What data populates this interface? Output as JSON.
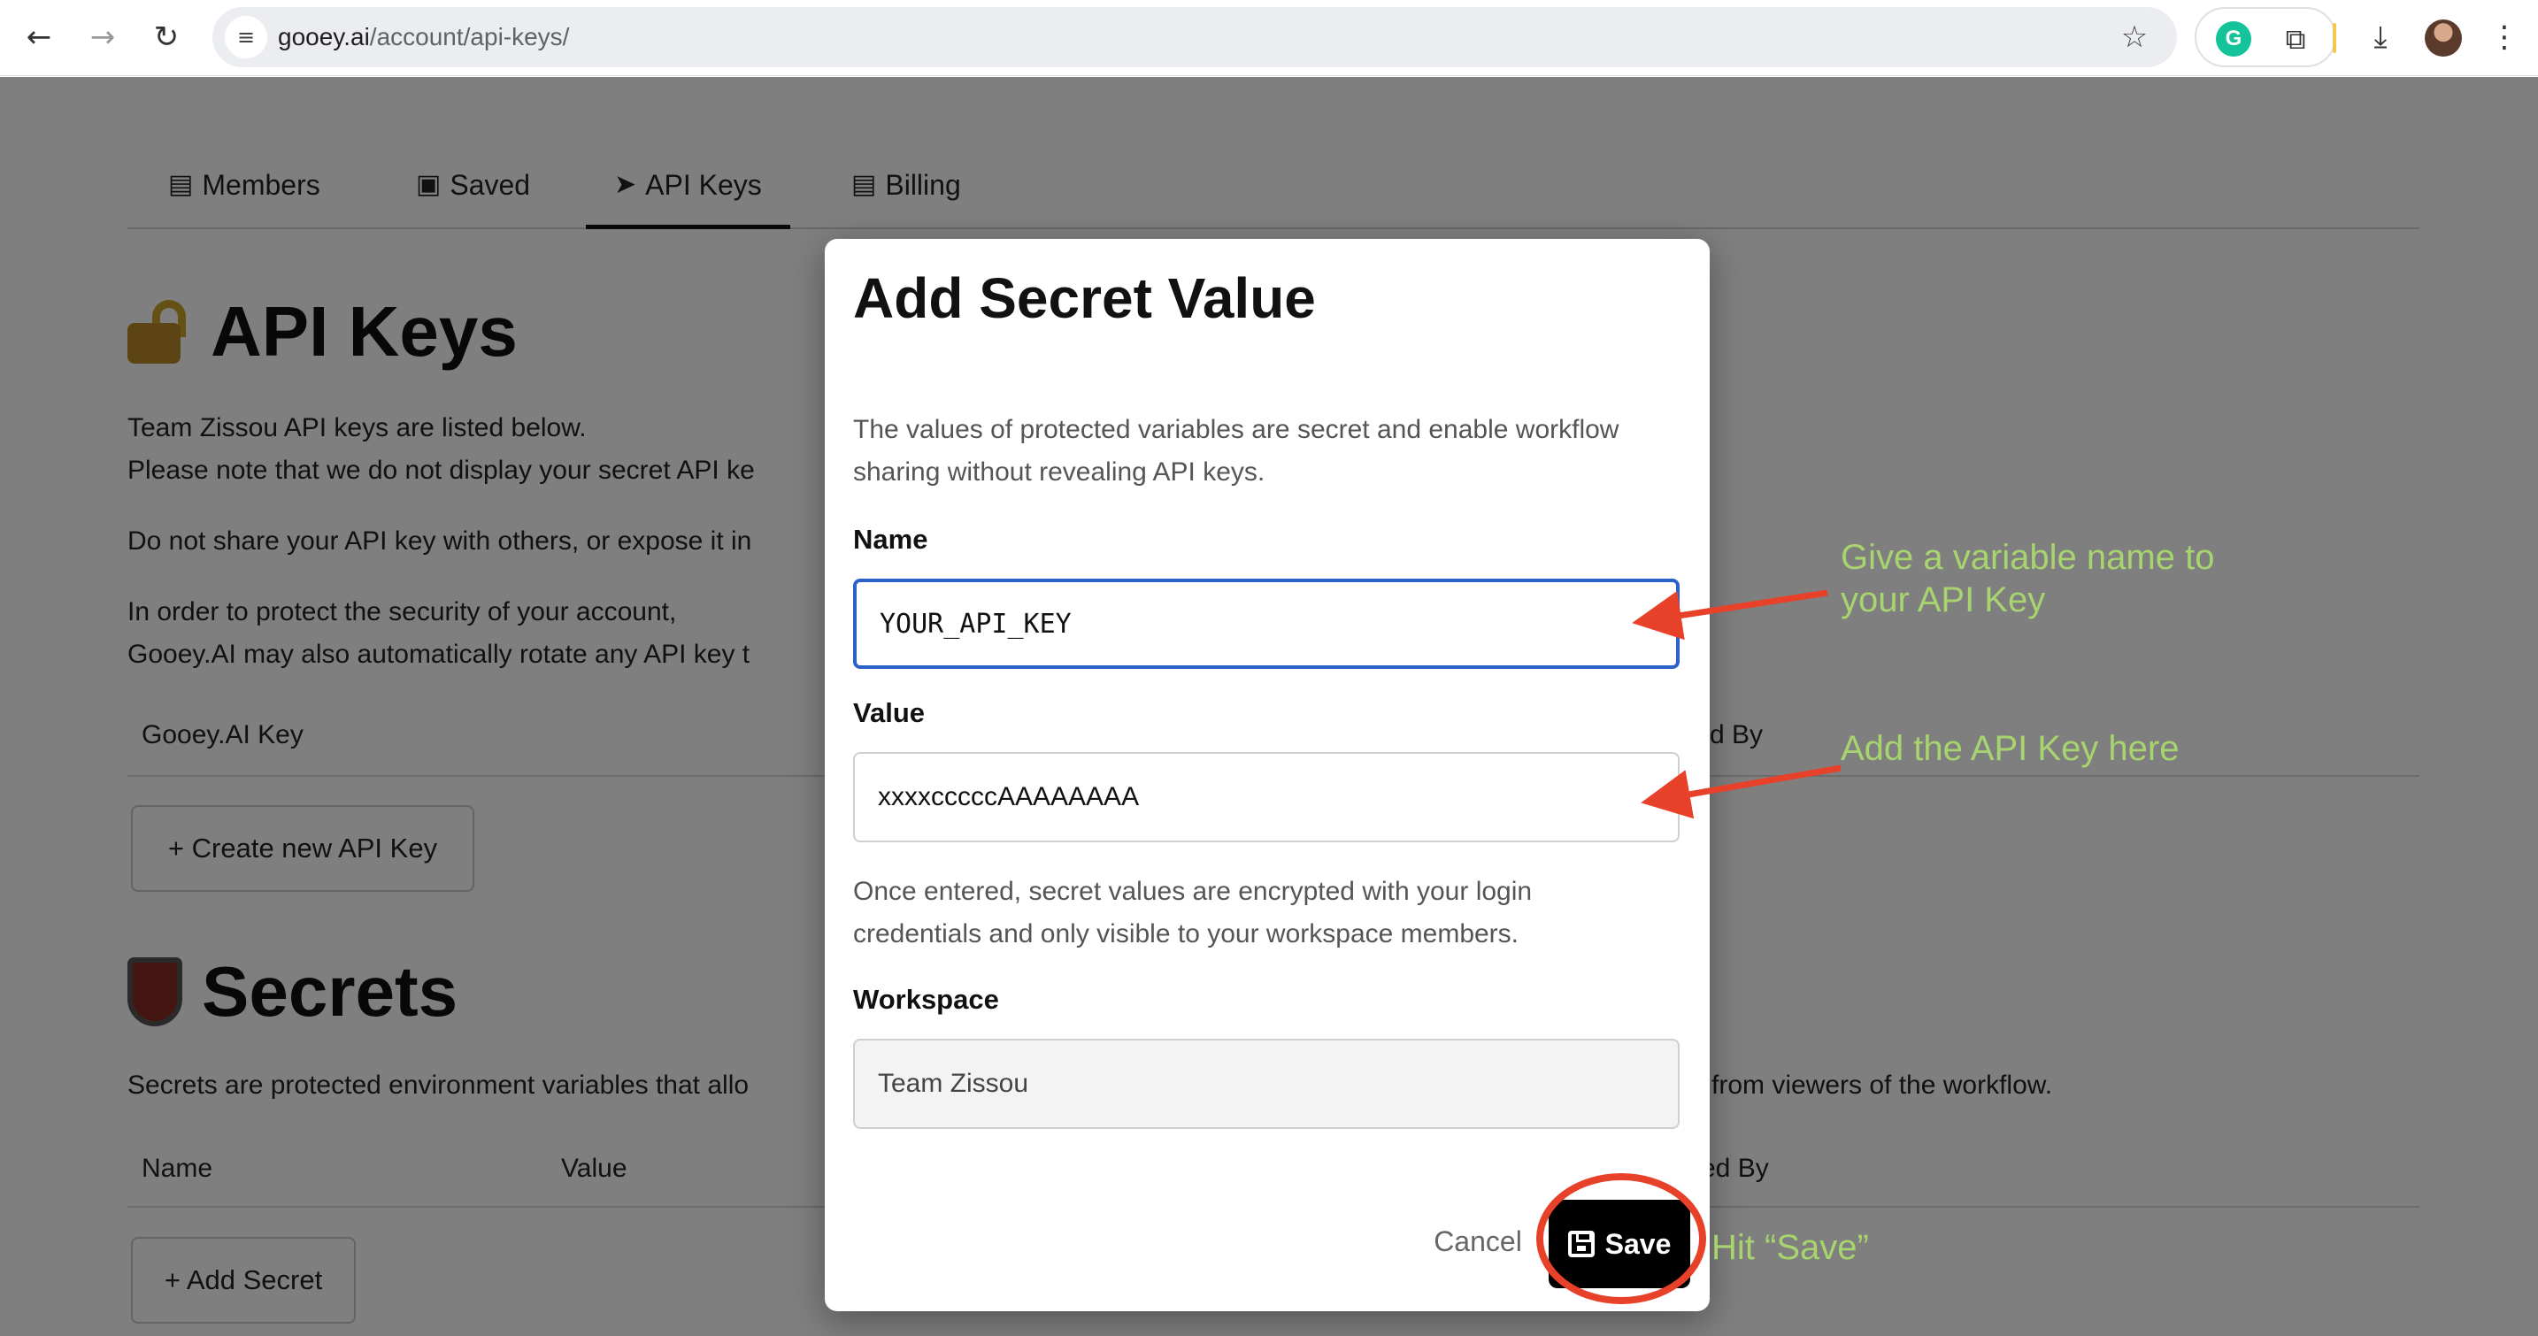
{
  "browser": {
    "url_host": "gooey.ai",
    "url_path": "/account/api-keys/"
  },
  "tabs": [
    {
      "label": "Members",
      "icon": "members-icon"
    },
    {
      "label": "Saved",
      "icon": "save-icon"
    },
    {
      "label": "API Keys",
      "icon": "rocket-icon",
      "active": true
    },
    {
      "label": "Billing",
      "icon": "billing-icon"
    }
  ],
  "api_keys_section": {
    "title": "API Keys",
    "line1": "Team Zissou API keys are listed below.",
    "line2": "Please note that we do not display your secret API ke",
    "line3": "Do not share your API key with others, or expose it in",
    "line4": "In order to protect the security of your account,",
    "line5": "Gooey.AI may also automatically rotate any API key t",
    "col_key": "Gooey.AI Key",
    "col_by": "d By",
    "create_button": "+ Create new API Key"
  },
  "secrets_section": {
    "title": "Secrets",
    "desc_left": "Secrets are protected environment variables that allo",
    "desc_right": "from viewers of the workflow.",
    "col_name": "Name",
    "col_value": "Value",
    "col_by": "ed By",
    "add_button": "+ Add Secret"
  },
  "modal": {
    "title": "Add Secret Value",
    "description": "The values of protected variables are secret and enable workflow sharing without revealing API keys.",
    "name_label": "Name",
    "name_value": "YOUR_API_KEY",
    "value_label": "Value",
    "value_value": "xxxxcccccAAAAAAAA",
    "note": "Once entered, secret values are encrypted with your login credentials and only visible to your workspace members.",
    "workspace_label": "Workspace",
    "workspace_value": "Team Zissou",
    "cancel_label": "Cancel",
    "save_label": "Save"
  },
  "annotations": {
    "name_hint_line1": "Give a variable name to",
    "name_hint_line2": "your API Key",
    "value_hint": "Add the API Key here",
    "save_hint": "Hit “Save”",
    "arrow_color": "#e8412a",
    "text_color": "#a8d46f"
  }
}
